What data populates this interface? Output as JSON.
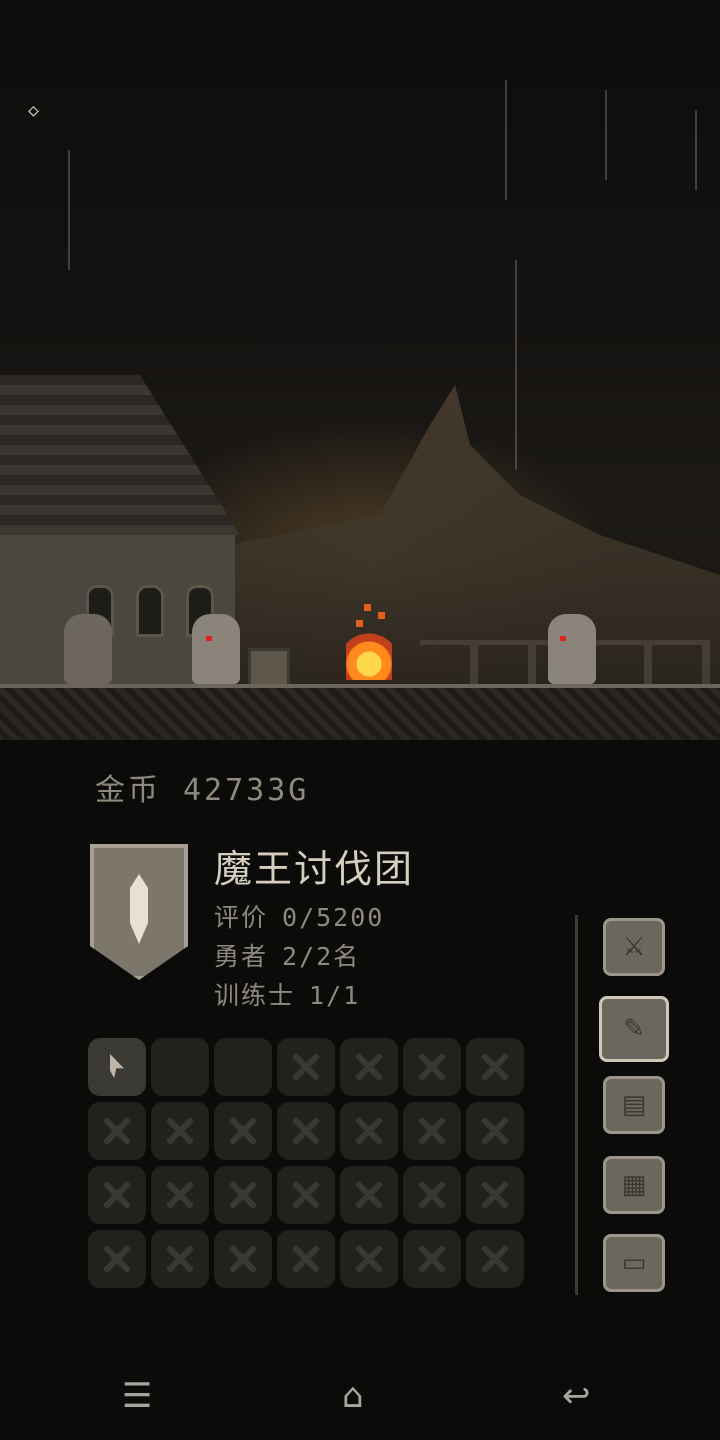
{
  "hud": {
    "settings_icon": "settings-diamond-icon"
  },
  "gold": {
    "label": "金币",
    "value": "42733G"
  },
  "party": {
    "name": "魔王讨伐团",
    "stats": [
      {
        "label": "评价",
        "value": "0/5200"
      },
      {
        "label": "勇者",
        "value": "2/2名"
      },
      {
        "label": "训练士",
        "value": "1/1"
      }
    ]
  },
  "slots": {
    "rows": 4,
    "cols": 7,
    "states": [
      "filled",
      "empty",
      "empty",
      "locked",
      "locked",
      "locked",
      "locked",
      "locked",
      "locked",
      "locked",
      "locked",
      "locked",
      "locked",
      "locked",
      "locked",
      "locked",
      "locked",
      "locked",
      "locked",
      "locked",
      "locked",
      "locked",
      "locked",
      "locked",
      "locked",
      "locked",
      "locked",
      "locked"
    ]
  },
  "side_menu": [
    {
      "name": "battle-button",
      "icon": "crossed-swords-icon",
      "glyph": "⚔",
      "active": false
    },
    {
      "name": "quest-button",
      "icon": "quill-scroll-icon",
      "glyph": "✎",
      "active": true
    },
    {
      "name": "map-button",
      "icon": "map-scroll-icon",
      "glyph": "▤",
      "active": false
    },
    {
      "name": "documents-button",
      "icon": "documents-icon",
      "glyph": "▦",
      "active": false
    },
    {
      "name": "computer-button",
      "icon": "monitor-icon",
      "glyph": "▭",
      "active": false
    }
  ],
  "navbar": {
    "menu_glyph": "☰",
    "home_glyph": "⌂",
    "back_glyph": "↩"
  },
  "colors": {
    "background": "#0b0b0a",
    "fire": "#ff8a1e",
    "text": "#8f897d",
    "title": "#d6cfc0"
  }
}
